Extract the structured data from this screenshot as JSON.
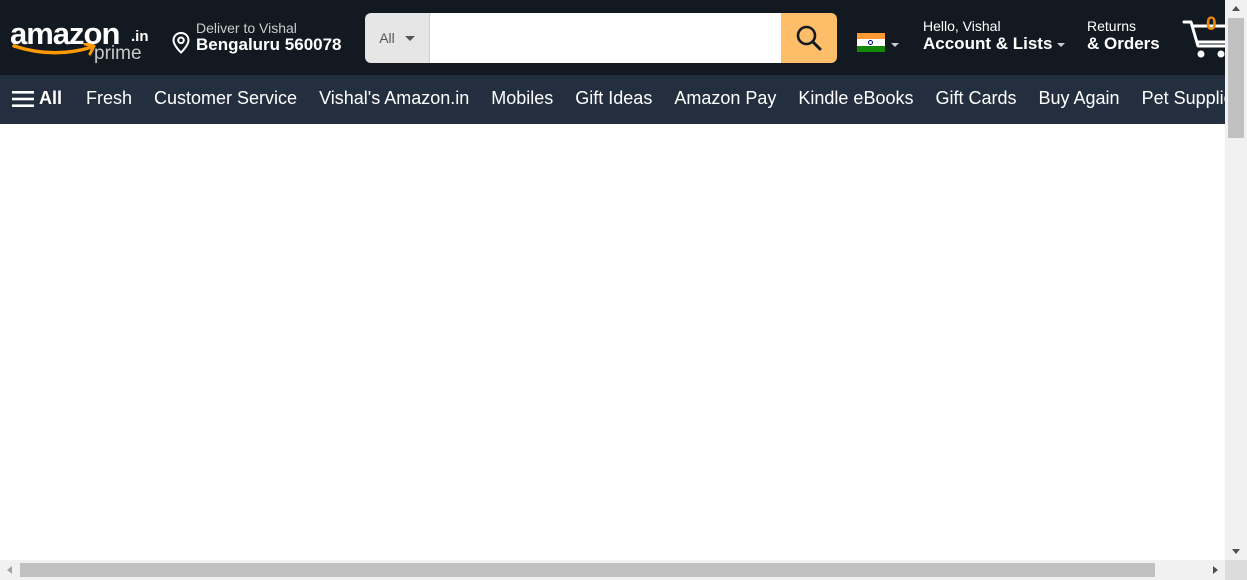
{
  "header": {
    "logo": {
      "word": "amazon",
      "tld": ".in",
      "sub": "prime"
    },
    "deliver": {
      "line1": "Deliver to Vishal",
      "line2": "Bengaluru 560078",
      "icon": "location-pin-icon"
    },
    "search": {
      "category": "All",
      "placeholder": "",
      "value": "",
      "button_icon": "search-icon"
    },
    "locale": {
      "flag": "india-flag-icon"
    },
    "account": {
      "line1": "Hello, Vishal",
      "line2": "Account & Lists"
    },
    "returns": {
      "line1": "Returns",
      "line2": "& Orders"
    },
    "cart": {
      "count": "0",
      "icon": "cart-icon"
    }
  },
  "nav": {
    "all_label": "All",
    "links": [
      "Fresh",
      "Customer Service",
      "Vishal's Amazon.in",
      "Mobiles",
      "Gift Ideas",
      "Amazon Pay",
      "Kindle eBooks",
      "Gift Cards",
      "Buy Again",
      "Pet Supplies"
    ]
  },
  "colors": {
    "nav_top": "#131921",
    "nav_main": "#232f3e",
    "search_button": "#febd69",
    "cart_count": "#f08804"
  }
}
